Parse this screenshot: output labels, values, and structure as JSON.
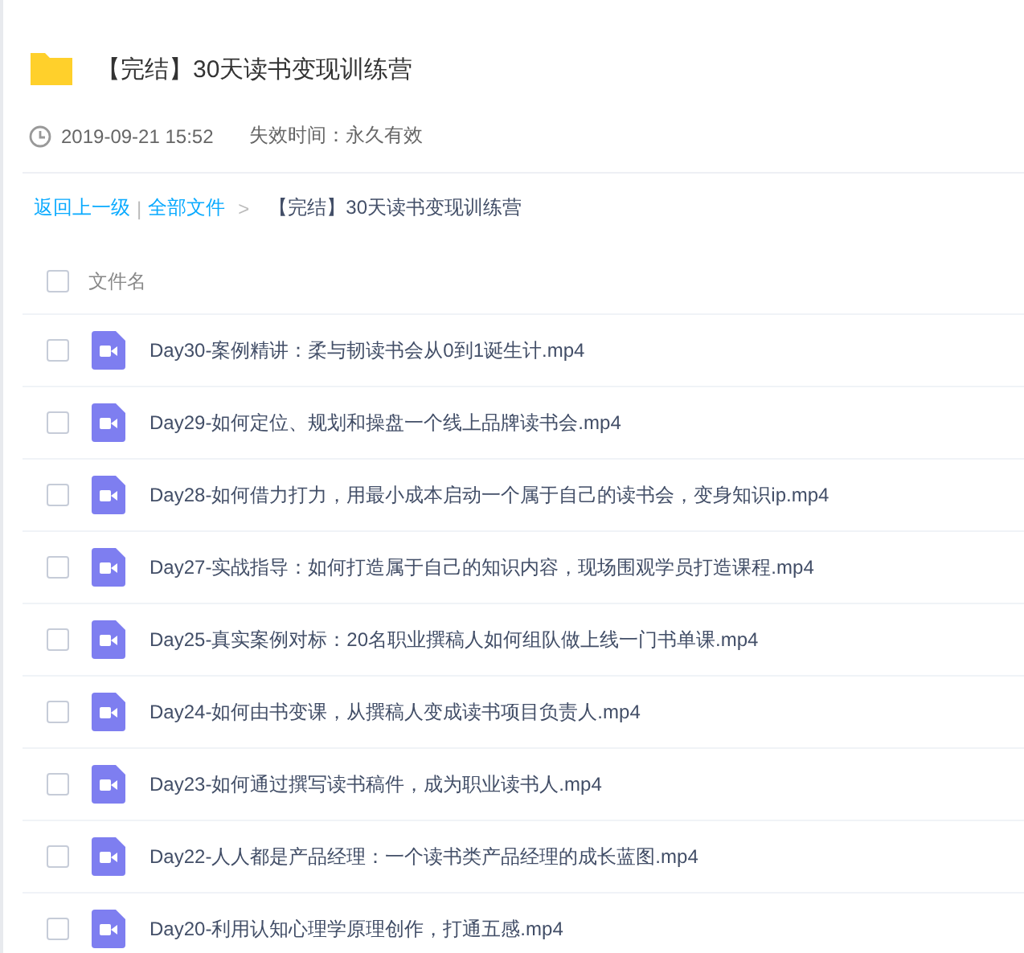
{
  "folder": {
    "title": "【完结】30天读书变现训练营",
    "date": "2019-09-21 15:52",
    "expiry": "失效时间：永久有效"
  },
  "breadcrumb": {
    "back": "返回上一级",
    "separator": "|",
    "all": "全部文件",
    "arrow": ">",
    "current": "【完结】30天读书变现训练营"
  },
  "table": {
    "header": {
      "label": "文件名",
      "checked": false
    },
    "rows": [
      {
        "name": "Day30-案例精讲：柔与韧读书会从0到1诞生计.mp4",
        "checked": false
      },
      {
        "name": "Day29-如何定位、规划和操盘一个线上品牌读书会.mp4",
        "checked": false
      },
      {
        "name": "Day28-如何借力打力，用最小成本启动一个属于自己的读书会，变身知识ip.mp4",
        "checked": false
      },
      {
        "name": "Day27-实战指导：如何打造属于自己的知识内容，现场围观学员打造课程.mp4",
        "checked": false
      },
      {
        "name": "Day25-真实案例对标：20名职业撰稿人如何组队做上线一门书单课.mp4",
        "checked": false
      },
      {
        "name": "Day24-如何由书变课，从撰稿人变成读书项目负责人.mp4",
        "checked": false
      },
      {
        "name": "Day23-如何通过撰写读书稿件，成为职业读书人.mp4",
        "checked": false
      },
      {
        "name": "Day22-人人都是产品经理：一个读书类产品经理的成长蓝图.mp4",
        "checked": false
      },
      {
        "name": "Day20-利用认知心理学原理创作，打通五感.mp4",
        "checked": false
      }
    ]
  }
}
